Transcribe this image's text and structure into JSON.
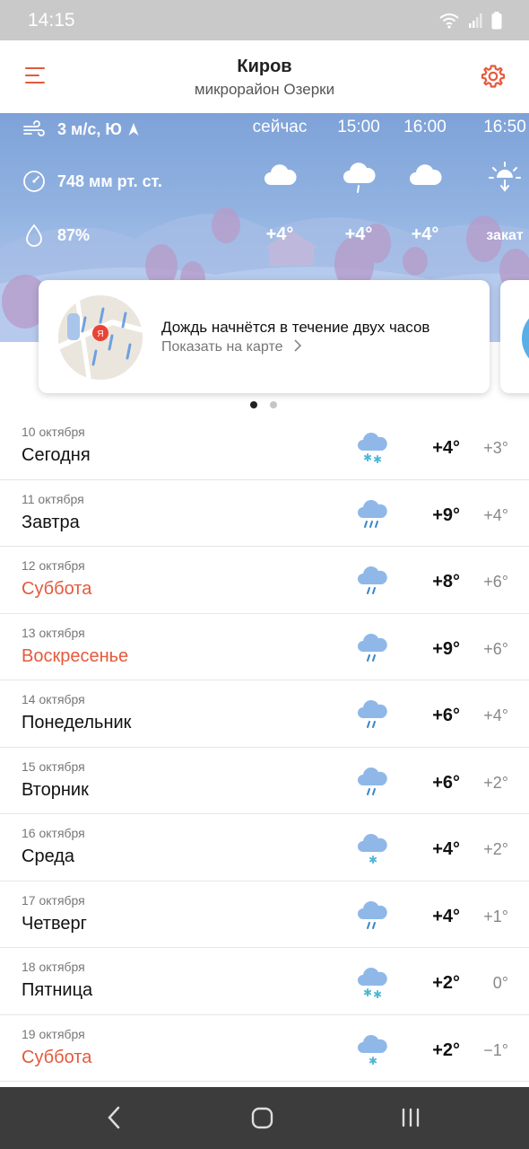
{
  "status_bar": {
    "time": "14:15"
  },
  "header": {
    "title": "Киров",
    "subtitle": "микрорайон Озерки"
  },
  "current": {
    "wind": "3 м/с, Ю",
    "pressure": "748 мм рт. ст.",
    "humidity": "87%"
  },
  "hourly": [
    {
      "time": "сейчас",
      "icon": "cloud-icon",
      "temp": "+4°"
    },
    {
      "time": "15:00",
      "icon": "cloud-rain-icon",
      "temp": "+4°"
    },
    {
      "time": "16:00",
      "icon": "cloud-icon",
      "temp": "+4°"
    },
    {
      "time": "16:50",
      "icon": "sunset-icon",
      "temp": "закат"
    }
  ],
  "precip_card": {
    "message": "Дождь начнётся в течение двух часов",
    "link": "Показать на карте",
    "map_badge": "Я"
  },
  "days": [
    {
      "date": "10 октября",
      "name": "Сегодня",
      "weekend": false,
      "icon": "cloud-snow-icon",
      "tmax": "+4°",
      "tmin": "+3°"
    },
    {
      "date": "11 октября",
      "name": "Завтра",
      "weekend": false,
      "icon": "cloud-heavy-rain-icon",
      "tmax": "+9°",
      "tmin": "+4°"
    },
    {
      "date": "12 октября",
      "name": "Суббота",
      "weekend": true,
      "icon": "cloud-rain-icon",
      "tmax": "+8°",
      "tmin": "+6°"
    },
    {
      "date": "13 октября",
      "name": "Воскресенье",
      "weekend": true,
      "icon": "cloud-rain-icon",
      "tmax": "+9°",
      "tmin": "+6°"
    },
    {
      "date": "14 октября",
      "name": "Понедельник",
      "weekend": false,
      "icon": "cloud-rain-icon",
      "tmax": "+6°",
      "tmin": "+4°"
    },
    {
      "date": "15 октября",
      "name": "Вторник",
      "weekend": false,
      "icon": "cloud-rain-icon",
      "tmax": "+6°",
      "tmin": "+2°"
    },
    {
      "date": "16 октября",
      "name": "Среда",
      "weekend": false,
      "icon": "cloud-light-snow-icon",
      "tmax": "+4°",
      "tmin": "+2°"
    },
    {
      "date": "17 октября",
      "name": "Четверг",
      "weekend": false,
      "icon": "cloud-rain-icon",
      "tmax": "+4°",
      "tmin": "+1°"
    },
    {
      "date": "18 октября",
      "name": "Пятница",
      "weekend": false,
      "icon": "cloud-snow-icon",
      "tmax": "+2°",
      "tmin": "0°"
    },
    {
      "date": "19 октября",
      "name": "Суббота",
      "weekend": true,
      "icon": "cloud-light-snow-icon",
      "tmax": "+2°",
      "tmin": "−1°"
    }
  ],
  "colors": {
    "accent": "#e5593c",
    "sky": "#8fb0e0",
    "icon_cloud": "#8fb8e8",
    "snow": "#4fb6d6"
  }
}
